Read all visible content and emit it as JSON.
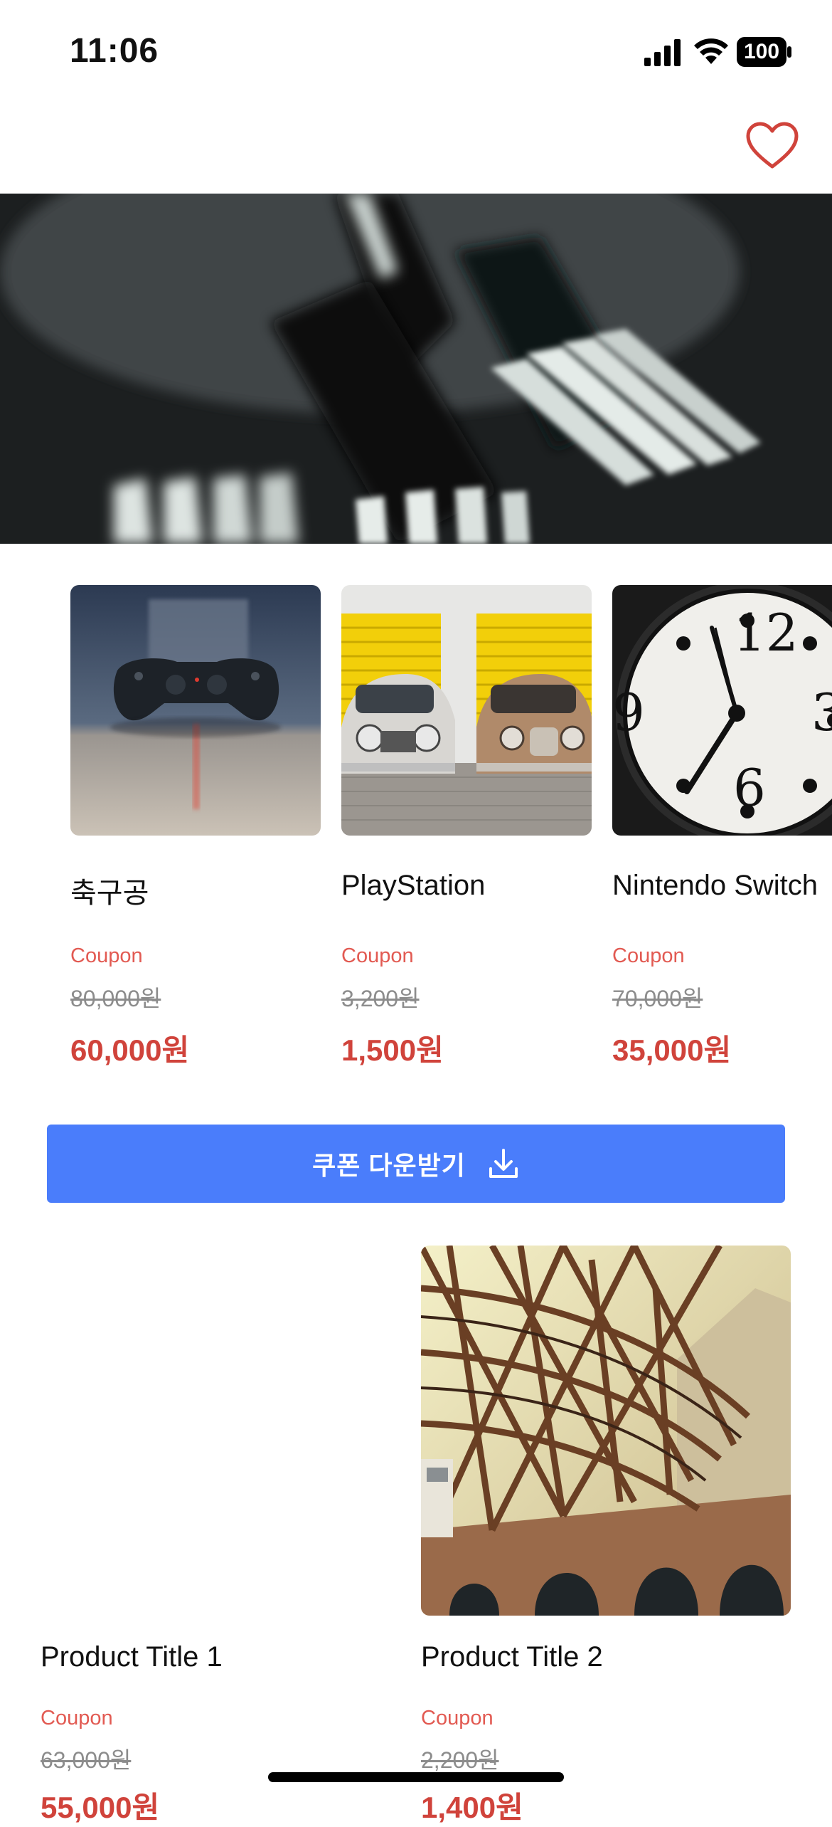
{
  "status_bar": {
    "time": "11:06",
    "battery": "100"
  },
  "header": {
    "favorite_icon": "heart-outline-icon",
    "accent_color": "#d0433b"
  },
  "hero": {
    "image": "blurred-forks-photo"
  },
  "carousel": {
    "items": [
      {
        "title": "축구공",
        "coupon_label": "Coupon",
        "original_price": "80,000원",
        "sale_price": "60,000원",
        "image": "game-controller-photo"
      },
      {
        "title": "PlayStation",
        "coupon_label": "Coupon",
        "original_price": "3,200원",
        "sale_price": "1,500원",
        "image": "vintage-cars-yellow-doors-photo"
      },
      {
        "title": "Nintendo Switch",
        "coupon_label": "Coupon",
        "original_price": "70,000원",
        "sale_price": "35,000원",
        "image": "clock-face-photo"
      }
    ]
  },
  "coupon_button": {
    "label": "쿠폰 다운받기",
    "icon": "download-icon",
    "color": "#4a7dfb"
  },
  "products": [
    {
      "title": "Product Title 1",
      "coupon_label": "Coupon",
      "original_price": "63,000원",
      "sale_price": "55,000원",
      "image": "blank"
    },
    {
      "title": "Product Title 2",
      "coupon_label": "Coupon",
      "original_price": "2,200원",
      "sale_price": "1,400원",
      "image": "steel-bridge-structure-photo"
    }
  ]
}
